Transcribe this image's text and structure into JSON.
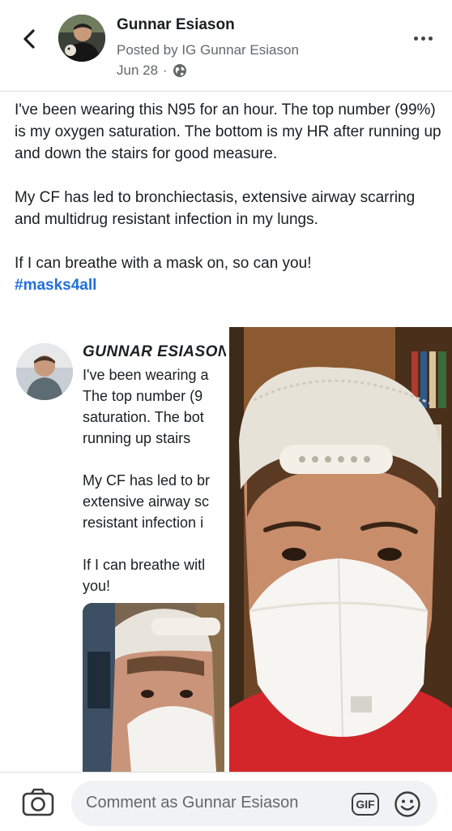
{
  "header": {
    "author": "Gunnar Esiason",
    "posted_by": "Posted by IG Gunnar Esiason",
    "date": "Jun 28",
    "separator": "·",
    "privacy_icon": "globe-icon",
    "back_icon": "chevron-left-icon",
    "more_icon": "more-horizontal-icon"
  },
  "post": {
    "paragraph1": "I've been wearing this N95 for an hour. The top number (99%) is my oxygen saturation. The bottom is my HR after running up and down the stairs for good measure.",
    "paragraph2": "My CF has led to bronchiectasis, extensive airway scarring and multidrug resistant infection in my lungs.",
    "paragraph3": "If I can breathe with a mask on, so can you!",
    "hashtag": "#masks4all"
  },
  "shared_screenshot": {
    "name": "GUNNAR ESIASON",
    "text": "I've been wearing a\nThe top number (9\nsaturation. The bot\nrunning up stairs\n\nMy CF has led to br\nextensive airway sc\nresistant infection i\n\nIf I can breathe witl\nyou!"
  },
  "composer": {
    "placeholder": "Comment as Gunnar Esiason",
    "gif_label": "GIF",
    "camera_icon": "camera-icon",
    "emoji_icon": "smiley-icon"
  },
  "colors": {
    "link": "#216fdb",
    "secondary_text": "#65676b",
    "composer_bg": "#f0f2f5"
  }
}
